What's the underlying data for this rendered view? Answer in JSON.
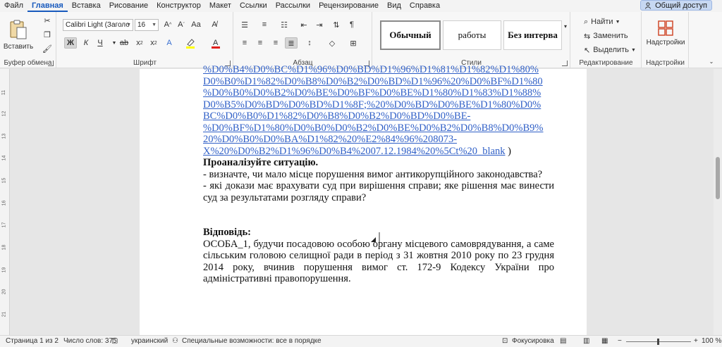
{
  "menu": {
    "tabs": [
      "Файл",
      "Главная",
      "Вставка",
      "Рисование",
      "Конструктор",
      "Макет",
      "Ссылки",
      "Рассылки",
      "Рецензирование",
      "Вид",
      "Справка"
    ],
    "share_label": "Общий доступ"
  },
  "ribbon": {
    "clipboard": {
      "paste_label": "Вставить",
      "group_label": "Буфер обмена"
    },
    "font": {
      "font_name": "Calibri Light (Заголо",
      "font_size": "16",
      "group_label": "Шрифт"
    },
    "paragraph": {
      "group_label": "Абзац"
    },
    "styles": {
      "items": [
        "Обычный",
        "работы",
        "Без интерва"
      ],
      "group_label": "Стили"
    },
    "editing": {
      "find_label": "Найти",
      "replace_label": "Заменить",
      "select_label": "Выделить",
      "group_label": "Редактирование"
    },
    "addins": {
      "label": "Надстройки",
      "group_label": "Надстройки"
    },
    "colors": {
      "highlight": "#ffff00",
      "font_color": "#e0201c",
      "accent": "#185abd"
    }
  },
  "document": {
    "link_lines": [
      "%D0%B4%D0%BC%D1%96%D0%BD%D1%96%D1%81%D1%82%D1%80%",
      "D0%B0%D1%82%D0%B8%D0%B2%D0%BD%D1%96%20%D0%BF%D1%80",
      "%D0%B0%D0%B2%D0%BE%D0%BF%D0%BE%D1%80%D1%83%D1%88%",
      "D0%B5%D0%BD%D0%BD%D1%8F;%20%D0%BD%D0%BE%D1%80%D0%",
      "BC%D0%B0%D1%82%D0%B8%D0%B2%D0%BD%D0%BE-",
      "%D0%BF%D1%80%D0%B0%D0%B2%D0%BE%D0%B2%D0%B8%D0%B9%",
      "20%D0%B0%D0%BA%D1%82%20%E2%84%96%208073-",
      "X%20%D0%B2%D1%96%D0%B4%2007.12.1984%20%5Ct%20_blank"
    ],
    "link_tail": " )",
    "heading_analyze": "Проаналізуйте ситуацію.",
    "question_1": "- визначте, чи мало місце порушення вимог антикорупційного законодавства?",
    "question_2": "- які докази має врахувати суд при вирішення справи; яке рішення має винести суд за результатами розгляду справи?",
    "answer_heading": "Відповідь:",
    "answer_text": "ОСОБА_1, будучи посадовою особою органу місцевого самоврядування, а саме сільським головою селищної ради в період з 31 жовтня 2010 року по 23 грудня 2014 року, вчинив порушення вимог ст. 172-9 Кодексу України про адміністративні правопорушення."
  },
  "status": {
    "page": "Страница 1 из 2",
    "words": "Число слов: 375",
    "language": "украинский",
    "accessibility": "Специальные возможности: все в порядке",
    "focus": "Фокусировка",
    "zoom": "100 %"
  }
}
